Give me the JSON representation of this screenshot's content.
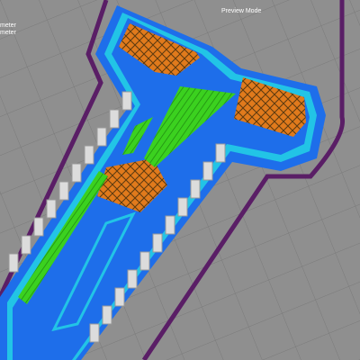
{
  "viewport": {
    "mode_label": "Preview Mode",
    "legend_lines": [
      "meter",
      "meter"
    ]
  },
  "colors": {
    "bed": "#8f8f8f",
    "grid": "#7a7a7a",
    "skirt": "#5a1e66",
    "perimeter_outer": "#1e6eea",
    "perimeter_inner": "#22c4e6",
    "infill": "#e07a1c",
    "solid_infill": "#3bd11f",
    "support": "#dcdcdc"
  },
  "icons": {
    "model": "3d-print-toolpath-preview"
  }
}
